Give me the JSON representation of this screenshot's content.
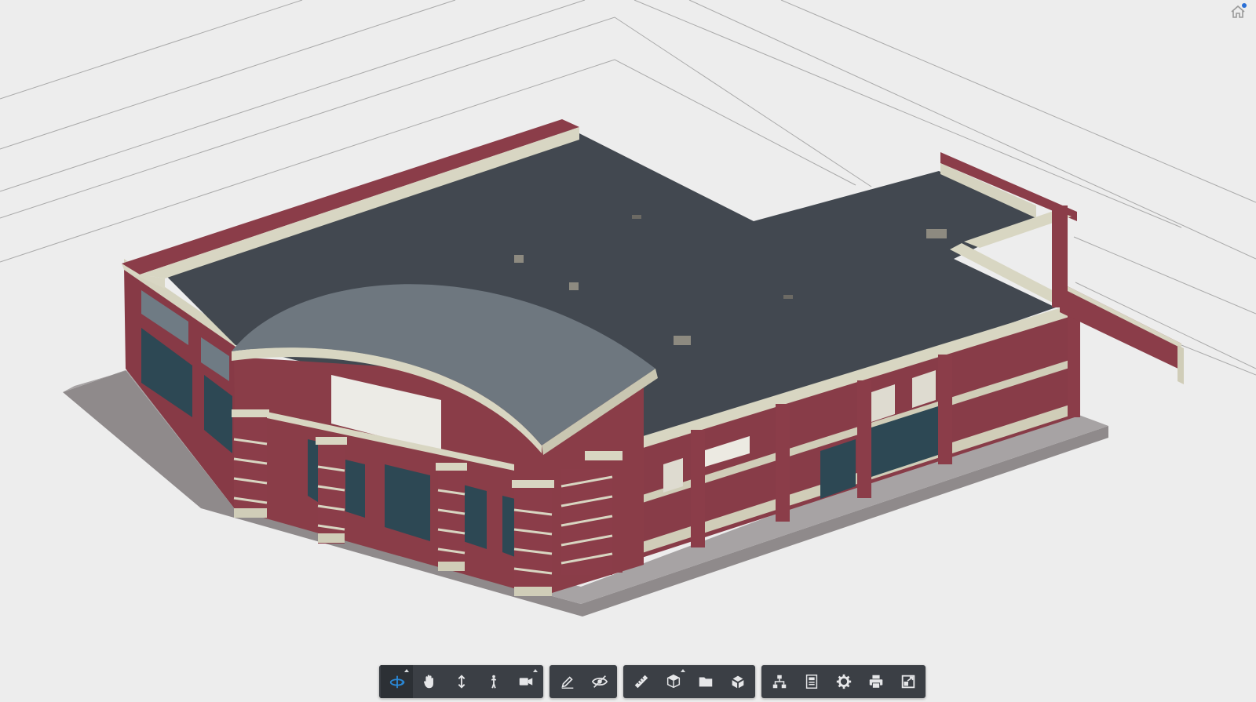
{
  "viewer": {
    "home_icon": "home-icon",
    "active_tool": "orbit"
  },
  "colors": {
    "background": "#ededed",
    "roof": "#43494f",
    "curved_roof": "#747c84",
    "brick": "#8b3f4a",
    "trim": "#d8d6c2",
    "glass": "#2f4a56",
    "sidewalk": "#9d999a",
    "toolbar": "#3b3f45",
    "active_blue": "#2a88d6"
  },
  "toolbar": {
    "groups": [
      {
        "name": "navigation",
        "tools": [
          {
            "id": "orbit",
            "icon": "orbit-icon",
            "active": true,
            "has_submenu": true
          },
          {
            "id": "pan",
            "icon": "pan-hand-icon",
            "active": false,
            "has_submenu": false
          },
          {
            "id": "zoom",
            "icon": "zoom-vertical-arrows-icon",
            "active": false,
            "has_submenu": false
          },
          {
            "id": "first-person",
            "icon": "first-person-walk-icon",
            "active": false,
            "has_submenu": false
          },
          {
            "id": "camera",
            "icon": "camera-icon",
            "active": false,
            "has_submenu": true
          }
        ]
      },
      {
        "name": "markup",
        "tools": [
          {
            "id": "markup",
            "icon": "pencil-markup-icon",
            "active": false,
            "has_submenu": false
          },
          {
            "id": "visibility",
            "icon": "eye-hide-icon",
            "active": false,
            "has_submenu": false
          }
        ]
      },
      {
        "name": "analysis",
        "tools": [
          {
            "id": "measure",
            "icon": "ruler-measure-icon",
            "active": false,
            "has_submenu": false
          },
          {
            "id": "section",
            "icon": "section-box-icon",
            "active": false,
            "has_submenu": true
          },
          {
            "id": "explode",
            "icon": "folder-icon",
            "active": false,
            "has_submenu": false
          },
          {
            "id": "model",
            "icon": "cube-explode-icon",
            "active": false,
            "has_submenu": false
          }
        ]
      },
      {
        "name": "settings",
        "tools": [
          {
            "id": "model-browser",
            "icon": "model-browser-tree-icon",
            "active": false,
            "has_submenu": false
          },
          {
            "id": "properties",
            "icon": "properties-panel-icon",
            "active": false,
            "has_submenu": false
          },
          {
            "id": "settings",
            "icon": "gear-icon",
            "active": false,
            "has_submenu": false
          },
          {
            "id": "print",
            "icon": "printer-icon",
            "active": false,
            "has_submenu": false
          },
          {
            "id": "fullscreen",
            "icon": "fullscreen-icon",
            "active": false,
            "has_submenu": false
          }
        ]
      }
    ]
  }
}
